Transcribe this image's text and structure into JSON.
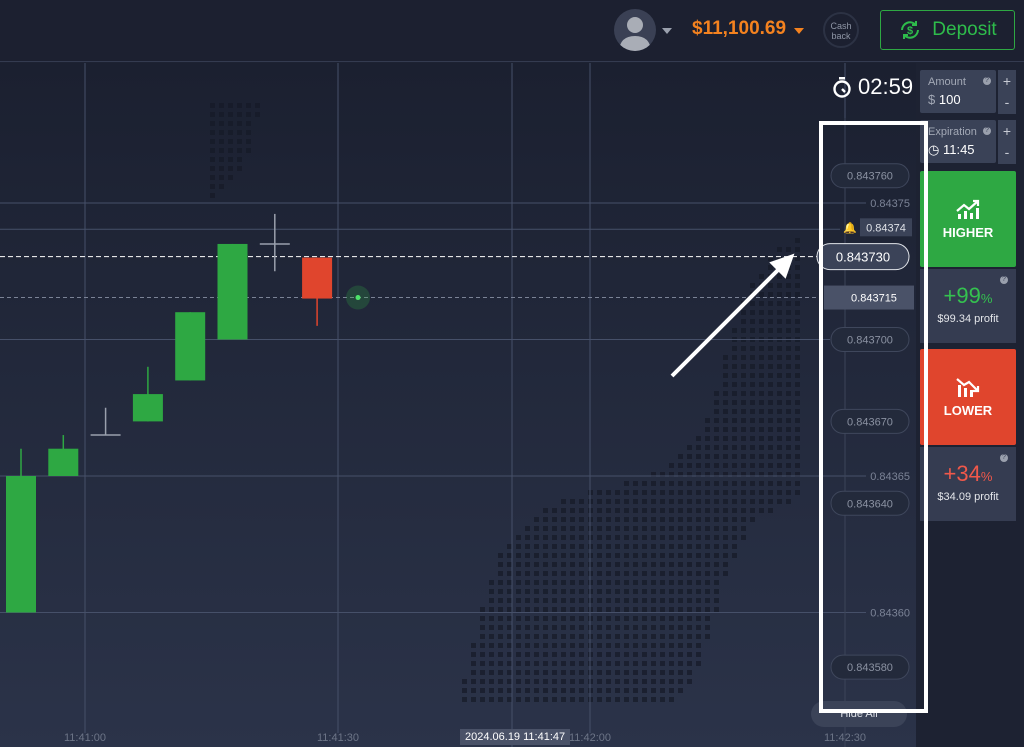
{
  "header": {
    "balance": "$11,100.69",
    "cashback": [
      "Cash",
      "back"
    ],
    "deposit_label": "Deposit"
  },
  "timer": "02:59",
  "amount": {
    "label": "Amount",
    "currency": "$",
    "value": "100",
    "plus": "+",
    "minus": "-"
  },
  "expiration": {
    "label": "Expiration",
    "value": "11:45",
    "plus": "+",
    "minus": "-"
  },
  "higher": {
    "label": "HIGHER",
    "percent": "+99",
    "pct_sign": "%",
    "profit": "$99.34 profit"
  },
  "lower": {
    "label": "LOWER",
    "percent": "+34",
    "pct_sign": "%",
    "profit": "$34.09 profit"
  },
  "hide_all": "Hide All",
  "timestamp": "2024.06.19 11:41:47",
  "colors": {
    "up": "#2ea843",
    "down": "#e0452d",
    "accent": "#f4821f"
  },
  "chart_data": {
    "type": "candlestick",
    "y_ticks": [
      "0.84375",
      "0.84365",
      "0.84360"
    ],
    "x_ticks": [
      "11:41:00",
      "11:41:30",
      "11:42:00",
      "11:42:30"
    ],
    "price_bubbles": [
      "0.843760",
      "0.843700",
      "0.843670",
      "0.843640",
      "0.843580"
    ],
    "current_price": "0.843715",
    "strike_price": "0.843730",
    "alert_price": "0.84374",
    "candles": [
      {
        "o": 0.8436,
        "c": 0.84365,
        "h": 0.84366,
        "l": 0.8436
      },
      {
        "o": 0.84365,
        "c": 0.84366,
        "h": 0.843665,
        "l": 0.84365
      },
      {
        "o": 0.843665,
        "c": 0.843665,
        "h": 0.843675,
        "l": 0.843665
      },
      {
        "o": 0.84367,
        "c": 0.84368,
        "h": 0.84369,
        "l": 0.84367
      },
      {
        "o": 0.843685,
        "c": 0.84371,
        "h": 0.84371,
        "l": 0.843685
      },
      {
        "o": 0.8437,
        "c": 0.843735,
        "h": 0.843735,
        "l": 0.8437
      },
      {
        "o": 0.843735,
        "c": 0.843735,
        "h": 0.843746,
        "l": 0.843725
      },
      {
        "o": 0.84373,
        "c": 0.843715,
        "h": 0.84373,
        "l": 0.843705
      }
    ]
  }
}
